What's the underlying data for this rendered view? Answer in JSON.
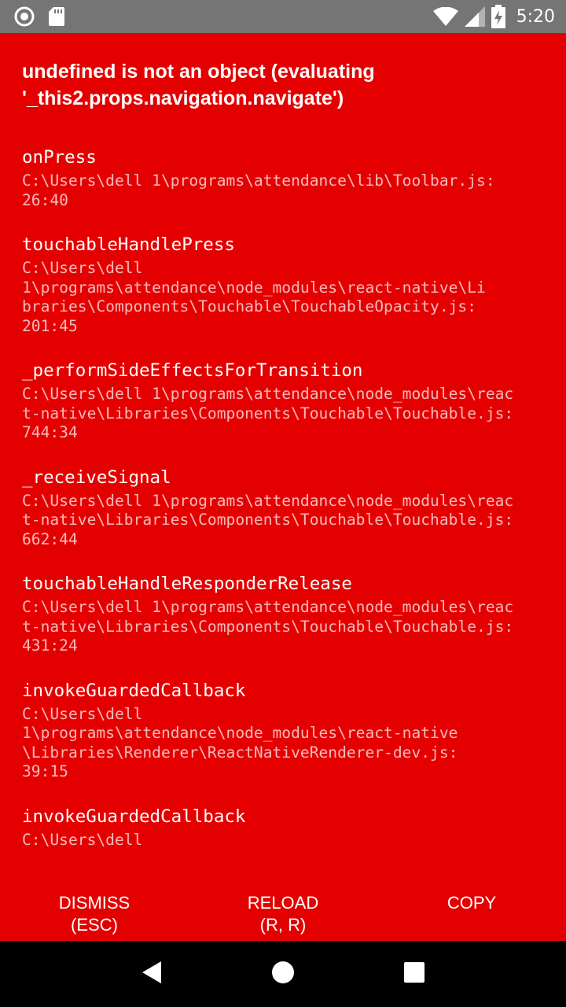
{
  "status_bar": {
    "time": "5:20",
    "icons": [
      "record-icon",
      "sd-card-icon",
      "wifi-icon",
      "cell-signal-icon",
      "battery-charging-icon"
    ]
  },
  "error": {
    "title": "undefined is not an object (evaluating '_this2.props.navigation.navigate')"
  },
  "stack": [
    {
      "method": "onPress",
      "file": "C:\\Users\\dell 1\\programs\\attendance\\lib\\Toolbar.js:\n26:40"
    },
    {
      "method": "touchableHandlePress",
      "file": "C:\\Users\\dell\n1\\programs\\attendance\\node_modules\\react-native\\Li\nbraries\\Components\\Touchable\\TouchableOpacity.js:\n201:45"
    },
    {
      "method": "_performSideEffectsForTransition",
      "file": "C:\\Users\\dell 1\\programs\\attendance\\node_modules\\reac\nt-native\\Libraries\\Components\\Touchable\\Touchable.js:\n744:34"
    },
    {
      "method": "_receiveSignal",
      "file": "C:\\Users\\dell 1\\programs\\attendance\\node_modules\\reac\nt-native\\Libraries\\Components\\Touchable\\Touchable.js:\n662:44"
    },
    {
      "method": "touchableHandleResponderRelease",
      "file": "C:\\Users\\dell 1\\programs\\attendance\\node_modules\\reac\nt-native\\Libraries\\Components\\Touchable\\Touchable.js:\n431:24"
    },
    {
      "method": "invokeGuardedCallback",
      "file": "C:\\Users\\dell\n1\\programs\\attendance\\node_modules\\react-native\n\\Libraries\\Renderer\\ReactNativeRenderer-dev.js:\n39:15"
    },
    {
      "method": "invokeGuardedCallback",
      "file": "C:\\Users\\dell"
    }
  ],
  "buttons": {
    "dismiss": "DISMISS\n(ESC)",
    "reload": "RELOAD\n(R, R)",
    "copy": "COPY"
  },
  "nav_bar": {
    "icons": [
      "back-icon",
      "home-icon",
      "recents-icon"
    ]
  },
  "colors": {
    "background": "#e40000",
    "status_bar": "#757575",
    "nav_bar": "#000000",
    "text": "#ffffff"
  }
}
